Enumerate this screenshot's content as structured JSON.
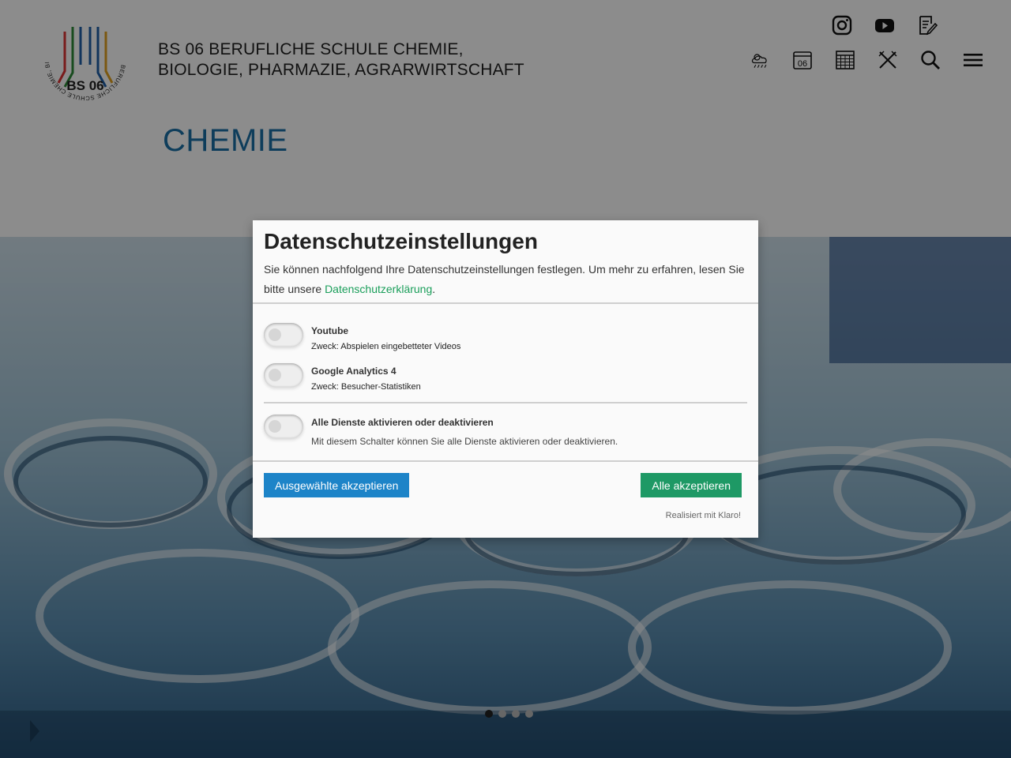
{
  "header": {
    "logo_text": "BS 06",
    "logo_ring_text": "BERUFLICHE SCHULE CHEMIE, BIOLOGIE, PHARMAZIE, AGRARWIRTSCHAFT",
    "school_name_line1": "BS 06 BERUFLICHE SCHULE CHEMIE,",
    "school_name_line2": "BIOLOGIE, PHARMAZIE, AGRARWIRTSCHAFT",
    "calendar_icon_text": "06"
  },
  "page_title": "CHEMIE",
  "consent": {
    "title": "Datenschutzeinstellungen",
    "description_before": "Sie können nachfolgend Ihre Datenschutzeinstellungen festlegen. Um mehr zu erfahren, lesen Sie bitte unsere ",
    "privacy_link": "Datenschutzerklärung",
    "description_after": ".",
    "services": [
      {
        "name": "Youtube",
        "purpose": "Zweck: Abspielen eingebetteter Videos",
        "enabled": false
      },
      {
        "name": "Google Analytics 4",
        "purpose": "Zweck: Besucher-Statistiken",
        "enabled": false
      }
    ],
    "all_toggle": {
      "name": "Alle Dienste aktivieren oder deaktivieren",
      "description": "Mit diesem Schalter können Sie alle Dienste aktivieren oder deaktivieren.",
      "enabled": false
    },
    "accept_selected": "Ausgewählte akzeptieren",
    "accept_all": "Alle akzeptieren",
    "powered_by": "Realisiert mit Klaro!"
  },
  "slider": {
    "slides": 4,
    "active_index": 0
  },
  "colors": {
    "title_blue": "#1a6fa6",
    "btn_blue": "#1d84c8",
    "btn_green": "#1e9965",
    "link_green": "#1a9e5a"
  },
  "icons": [
    "instagram-icon",
    "youtube-icon",
    "form-edit-icon",
    "weather-icon",
    "calendar-day-icon",
    "calendar-grid-icon",
    "cutlery-icon",
    "search-icon",
    "menu-icon"
  ]
}
